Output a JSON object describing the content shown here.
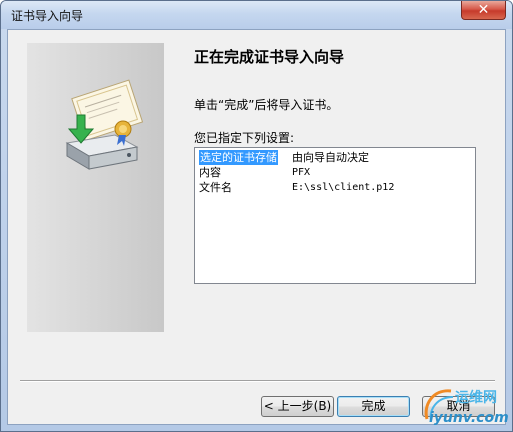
{
  "window": {
    "title": "证书导入向导",
    "close_glyph": "✕"
  },
  "wizard": {
    "heading": "正在完成证书导入向导",
    "instruction": "单击“完成”后将导入证书。",
    "settings_label": "您已指定下列设置:",
    "settings": [
      {
        "name": "选定的证书存储",
        "value": "由向导自动决定",
        "selected": true
      },
      {
        "name": "内容",
        "value": "PFX",
        "selected": false
      },
      {
        "name": "文件名",
        "value": "E:\\ssl\\client.p12",
        "selected": false
      }
    ],
    "icon": "certificate-import-icon"
  },
  "buttons": {
    "back_label": "< 上一步(B)",
    "finish_label": "完成",
    "cancel_label": "取消"
  },
  "watermark": {
    "text_cn": "运维网",
    "text_en": "iyunv.com"
  },
  "colors": {
    "selection": "#3399ff",
    "close_button": "#c63a2b",
    "panel_gray": "#d3d3d3"
  }
}
